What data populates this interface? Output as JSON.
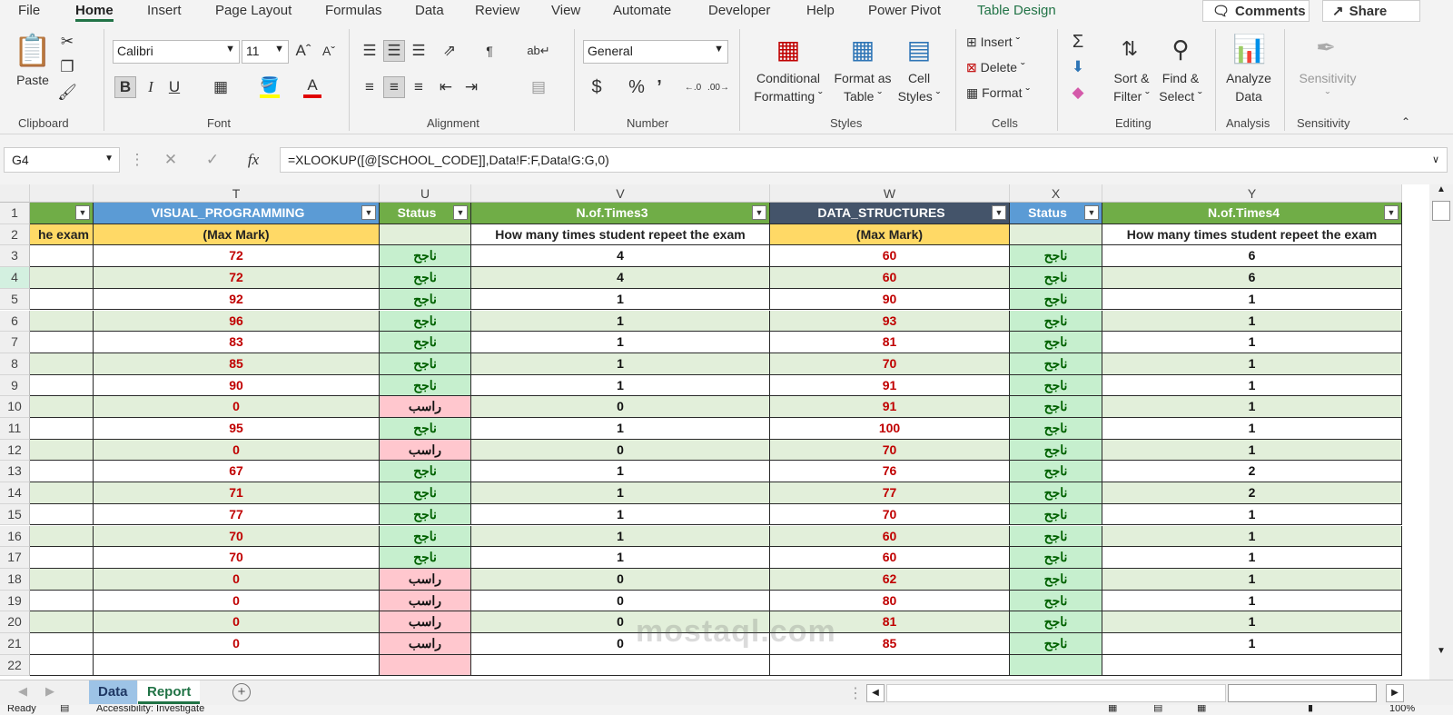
{
  "menu": {
    "tabs": [
      "File",
      "Home",
      "Insert",
      "Page Layout",
      "Formulas",
      "Data",
      "Review",
      "View",
      "Automate",
      "Developer",
      "Help",
      "Power Pivot",
      "Table Design"
    ],
    "comments": "Comments",
    "share": "Share"
  },
  "ribbon": {
    "clipboard": {
      "paste": "Paste",
      "label": "Clipboard"
    },
    "font": {
      "name": "Calibri",
      "size": "11",
      "label": "Font"
    },
    "alignment": {
      "label": "Alignment"
    },
    "number": {
      "format": "General",
      "label": "Number"
    },
    "styles": {
      "conditional_1": "Conditional",
      "conditional_2": "Formatting",
      "format_table_1": "Format as",
      "format_table_2": "Table",
      "cell_styles_1": "Cell",
      "cell_styles_2": "Styles",
      "label": "Styles"
    },
    "cells": {
      "insert": "Insert",
      "delete": "Delete",
      "format": "Format",
      "label": "Cells"
    },
    "editing": {
      "sort_1": "Sort &",
      "sort_2": "Filter",
      "find_1": "Find &",
      "find_2": "Select",
      "label": "Editing"
    },
    "analysis": {
      "analyze_1": "Analyze",
      "analyze_2": "Data",
      "label": "Analysis"
    },
    "sensitivity": {
      "button": "Sensitivity",
      "label": "Sensitivity"
    }
  },
  "formula_bar": {
    "name_box": "G4",
    "formula": "=XLOOKUP([@[SCHOOL_CODE]],Data!F:F,Data!G:G,0)"
  },
  "grid": {
    "columns": [
      "T",
      "U",
      "V",
      "W",
      "X",
      "Y"
    ],
    "headers": [
      "VISUAL_PROGRAMMING",
      "Status",
      "N.of.Times3",
      "DATA_STRUCTURES",
      "Status",
      "N.of.Times4"
    ],
    "subheaders": [
      "(Max Mark)",
      "",
      "How many times student repeet the exam",
      "(Max Mark)",
      "",
      "How many times student repeet the exam"
    ],
    "left_partial_subheader": "he exam",
    "rows": [
      {
        "n": "3",
        "t": "72",
        "u": "ناجح",
        "v": "4",
        "w": "60",
        "x": "ناجح",
        "y": "6"
      },
      {
        "n": "4",
        "t": "72",
        "u": "ناجح",
        "v": "4",
        "w": "60",
        "x": "ناجح",
        "y": "6"
      },
      {
        "n": "5",
        "t": "92",
        "u": "ناجح",
        "v": "1",
        "w": "90",
        "x": "ناجح",
        "y": "1"
      },
      {
        "n": "6",
        "t": "96",
        "u": "ناجح",
        "v": "1",
        "w": "93",
        "x": "ناجح",
        "y": "1"
      },
      {
        "n": "7",
        "t": "83",
        "u": "ناجح",
        "v": "1",
        "w": "81",
        "x": "ناجح",
        "y": "1"
      },
      {
        "n": "8",
        "t": "85",
        "u": "ناجح",
        "v": "1",
        "w": "70",
        "x": "ناجح",
        "y": "1"
      },
      {
        "n": "9",
        "t": "90",
        "u": "ناجح",
        "v": "1",
        "w": "91",
        "x": "ناجح",
        "y": "1"
      },
      {
        "n": "10",
        "t": "0",
        "u": "راسب",
        "v": "0",
        "w": "91",
        "x": "ناجح",
        "y": "1"
      },
      {
        "n": "11",
        "t": "95",
        "u": "ناجح",
        "v": "1",
        "w": "100",
        "x": "ناجح",
        "y": "1"
      },
      {
        "n": "12",
        "t": "0",
        "u": "راسب",
        "v": "0",
        "w": "70",
        "x": "ناجح",
        "y": "1"
      },
      {
        "n": "13",
        "t": "67",
        "u": "ناجح",
        "v": "1",
        "w": "76",
        "x": "ناجح",
        "y": "2"
      },
      {
        "n": "14",
        "t": "71",
        "u": "ناجح",
        "v": "1",
        "w": "77",
        "x": "ناجح",
        "y": "2"
      },
      {
        "n": "15",
        "t": "77",
        "u": "ناجح",
        "v": "1",
        "w": "70",
        "x": "ناجح",
        "y": "1"
      },
      {
        "n": "16",
        "t": "70",
        "u": "ناجح",
        "v": "1",
        "w": "60",
        "x": "ناجح",
        "y": "1"
      },
      {
        "n": "17",
        "t": "70",
        "u": "ناجح",
        "v": "1",
        "w": "60",
        "x": "ناجح",
        "y": "1"
      },
      {
        "n": "18",
        "t": "0",
        "u": "راسب",
        "v": "0",
        "w": "62",
        "x": "ناجح",
        "y": "1"
      },
      {
        "n": "19",
        "t": "0",
        "u": "راسب",
        "v": "0",
        "w": "80",
        "x": "ناجح",
        "y": "1"
      },
      {
        "n": "20",
        "t": "0",
        "u": "راسب",
        "v": "0",
        "w": "81",
        "x": "ناجح",
        "y": "1"
      },
      {
        "n": "21",
        "t": "0",
        "u": "راسب",
        "v": "0",
        "w": "85",
        "x": "ناجح",
        "y": "1"
      }
    ]
  },
  "colors": {
    "excel_green": "#217346",
    "header_blue": "#5b9bd5",
    "header_green": "#70ad47",
    "header_navy": "#44546a",
    "subheader_yellow": "#ffd966",
    "pass_green": "#c6efce",
    "fail_red": "#ffc7ce",
    "band": "#e2efda",
    "mark_red": "#c00000",
    "status_green": "#006100"
  },
  "sheets": {
    "tabs": [
      "Data",
      "Report"
    ],
    "active": "Report"
  },
  "status": {
    "ready": "Ready",
    "accessibility": "Accessibility: Investigate",
    "zoom": "100%"
  },
  "watermark": "mostaql.com"
}
